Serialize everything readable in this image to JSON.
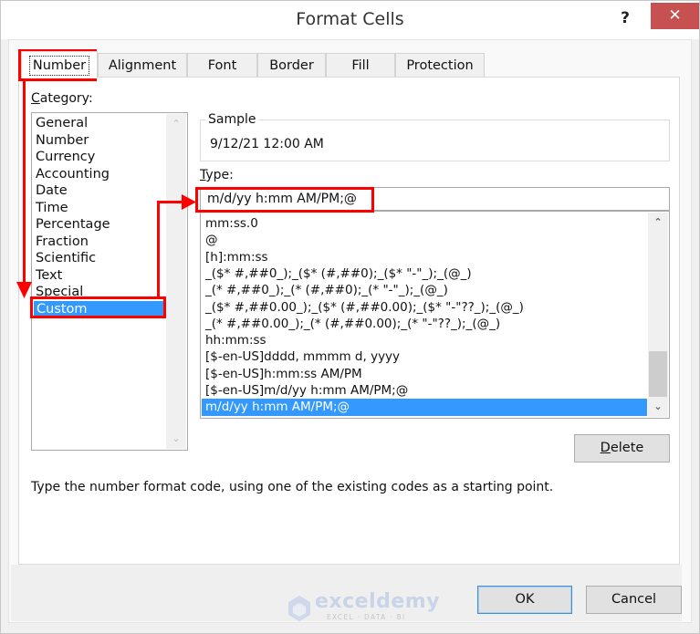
{
  "window": {
    "title": "Format Cells",
    "help_label": "?",
    "close_label": "✕"
  },
  "tabs": [
    {
      "label": "Number",
      "active": true
    },
    {
      "label": "Alignment",
      "active": false
    },
    {
      "label": "Font",
      "active": false
    },
    {
      "label": "Border",
      "active": false
    },
    {
      "label": "Fill",
      "active": false
    },
    {
      "label": "Protection",
      "active": false
    }
  ],
  "category": {
    "label_accel": "C",
    "label_rest": "ategory:",
    "items": [
      "General",
      "Number",
      "Currency",
      "Accounting",
      "Date",
      "Time",
      "Percentage",
      "Fraction",
      "Scientific",
      "Text",
      "Special",
      "Custom"
    ],
    "selected": "Custom"
  },
  "sample": {
    "label": "Sample",
    "value": "9/12/21 12:00 AM"
  },
  "type": {
    "label_accel": "T",
    "label_rest": "ype:",
    "value": "m/d/yy h:mm AM/PM;@",
    "formats": [
      "mm:ss.0",
      "@",
      "[h]:mm:ss",
      "_($* #,##0_);_($* (#,##0);_($* \"-\"_);_(@_)",
      "_(* #,##0_);_(* (#,##0);_(* \"-\"_);_(@_)",
      "_($* #,##0.00_);_($* (#,##0.00);_($* \"-\"??_);_(@_)",
      "_(* #,##0.00_);_(* (#,##0.00);_(* \"-\"??_);_(@_)",
      "hh:mm:ss",
      "[$-en-US]dddd, mmmm d, yyyy",
      "[$-en-US]h:mm:ss AM/PM",
      "[$-en-US]m/d/yy h:mm AM/PM;@",
      "m/d/yy h:mm AM/PM;@"
    ],
    "selected": "m/d/yy h:mm AM/PM;@"
  },
  "buttons": {
    "delete_accel": "D",
    "delete_rest": "elete",
    "ok": "OK",
    "cancel": "Cancel"
  },
  "hint": "Type the number format code, using one of the existing codes as a starting point.",
  "scroll_icons": {
    "up": "⌃",
    "down": "⌄"
  },
  "watermark": {
    "brand": "exceldemy",
    "tagline": "EXCEL · DATA · BI"
  },
  "colors": {
    "selection": "#3399ff",
    "annotation": "#ff0000",
    "close_button": "#c75050"
  }
}
